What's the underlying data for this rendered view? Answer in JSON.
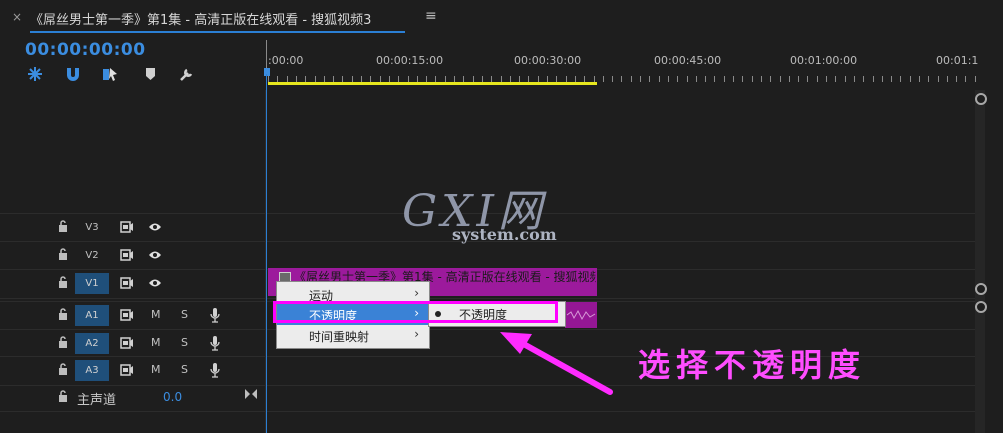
{
  "window": {
    "title": "《屌丝男士第一季》第1集 - 高清正版在线观看 - 搜狐视频3",
    "close_glyph": "×",
    "menu_glyph": "≡"
  },
  "timeline": {
    "timecode": "00:00:00:00",
    "ruler_labels": [
      ":00:00",
      "00:00:15:00",
      "00:00:30:00",
      "00:00:45:00",
      "00:01:00:00",
      "00:01:1"
    ],
    "tools": [
      "ripple-icon",
      "magnet-icon",
      "linked-selection-icon",
      "marker-icon",
      "wrench-icon"
    ]
  },
  "tracks": {
    "video": [
      {
        "label": "V3",
        "active": false
      },
      {
        "label": "V2",
        "active": false
      },
      {
        "label": "V1",
        "active": true
      }
    ],
    "audio": [
      {
        "label": "A1",
        "m": "M",
        "s": "S"
      },
      {
        "label": "A2",
        "m": "M",
        "s": "S"
      },
      {
        "label": "A3",
        "m": "M",
        "s": "S"
      }
    ],
    "master": {
      "label": "主声道",
      "value": "0.0"
    }
  },
  "clip": {
    "title": "《屌丝男士第一季》第1集 - 高清正版在线观看 - 搜狐视频",
    "fx_badge": "fx"
  },
  "context_menu": {
    "items": [
      {
        "label": "运动",
        "arrow": "›"
      },
      {
        "label": "不透明度",
        "arrow": "›"
      },
      {
        "label": "时间重映射",
        "arrow": "›"
      }
    ],
    "submenu_item": "不透明度"
  },
  "watermark": {
    "big": "GXI网",
    "small": "system.com"
  },
  "annotation": {
    "text": "选择不透明度",
    "color": "#ff33ff"
  },
  "colors": {
    "accent": "#2b7fd4",
    "clip": "#9c1a9c",
    "workarea": "#e6e61e"
  }
}
